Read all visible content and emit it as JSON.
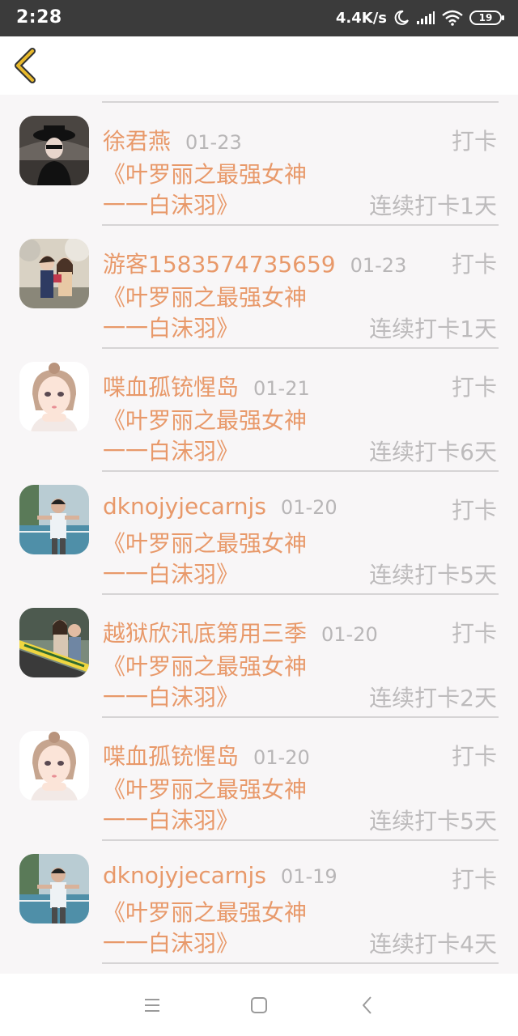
{
  "status_bar": {
    "time": "2:28",
    "network_speed": "4.4K/s",
    "battery_level": "19"
  },
  "header": {
    "back_icon": "chevron-left-icon",
    "accent_color": "#e8b92b"
  },
  "colors": {
    "name": "#e8996a",
    "muted": "#bdbbbc",
    "background": "#f8f6f7"
  },
  "records": [
    {
      "name": "徐君燕",
      "date": "01-23",
      "checkin_label": "打卡",
      "book_line1": "《叶罗丽之最强女神",
      "book_line2": "一一白沫羽》",
      "streak": "连续打卡1天",
      "avatar": "avatar-dark-hat"
    },
    {
      "name": "游客1583574735659",
      "date": "01-23",
      "checkin_label": "打卡",
      "book_line1": "《叶罗丽之最强女神",
      "book_line2": "一一白沫羽》",
      "streak": "连续打卡1天",
      "avatar": "avatar-couple"
    },
    {
      "name": "喋血孤铳惺岛",
      "date": "01-21",
      "checkin_label": "打卡",
      "book_line1": "《叶罗丽之最强女神",
      "book_line2": "一一白沫羽》",
      "streak": "连续打卡6天",
      "avatar": "avatar-cartoon-girl"
    },
    {
      "name": "dknojyjecarnjs",
      "date": "01-20",
      "checkin_label": "打卡",
      "book_line1": "《叶罗丽之最强女神",
      "book_line2": "一一白沫羽》",
      "streak": "连续打卡5天",
      "avatar": "avatar-boy-court"
    },
    {
      "name": "越狱欣汛底第用三季",
      "date": "01-20",
      "checkin_label": "打卡",
      "book_line1": "《叶罗丽之最强女神",
      "book_line2": "一一白沫羽》",
      "streak": "连续打卡2天",
      "avatar": "avatar-couple-banner"
    },
    {
      "name": "喋血孤铳惺岛",
      "date": "01-20",
      "checkin_label": "打卡",
      "book_line1": "《叶罗丽之最强女神",
      "book_line2": "一一白沫羽》",
      "streak": "连续打卡5天",
      "avatar": "avatar-cartoon-girl"
    },
    {
      "name": "dknojyjecarnjs",
      "date": "01-19",
      "checkin_label": "打卡",
      "book_line1": "《叶罗丽之最强女神",
      "book_line2": "一一白沫羽》",
      "streak": "连续打卡4天",
      "avatar": "avatar-boy-court"
    }
  ],
  "nav_bar": {
    "menu_icon": "menu-icon",
    "home_icon": "home-square-icon",
    "back_icon": "back-triangle-icon"
  }
}
